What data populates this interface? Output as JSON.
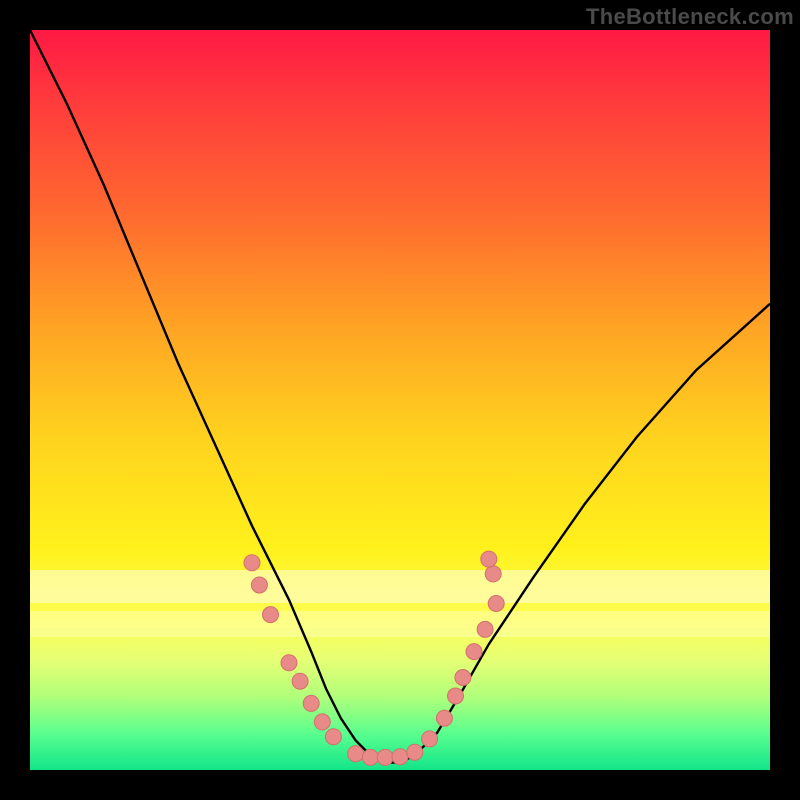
{
  "source_label": "TheBottleneck.com",
  "colors": {
    "curve": "#000000",
    "marker_fill": "#e88a87",
    "marker_stroke": "#d46f6c"
  },
  "chart_data": {
    "type": "line",
    "title": "",
    "xlabel": "",
    "ylabel": "",
    "xlim": [
      0,
      100
    ],
    "ylim": [
      0,
      100
    ],
    "series": [
      {
        "name": "bottleneck-curve",
        "x": [
          0,
          5,
          10,
          15,
          20,
          25,
          30,
          35,
          38,
          40,
          42,
          44,
          46,
          48,
          50,
          52,
          55,
          58,
          62,
          68,
          75,
          82,
          90,
          100
        ],
        "y": [
          100,
          90,
          79,
          67,
          55,
          44,
          33,
          23,
          16,
          11,
          7,
          4,
          2,
          1,
          1,
          2,
          5,
          10,
          17,
          26,
          36,
          45,
          54,
          63
        ]
      }
    ],
    "markers": {
      "name": "highlighted-points",
      "points": [
        {
          "x": 30.0,
          "y": 28.0
        },
        {
          "x": 31.0,
          "y": 25.0
        },
        {
          "x": 32.5,
          "y": 21.0
        },
        {
          "x": 35.0,
          "y": 14.5
        },
        {
          "x": 36.5,
          "y": 12.0
        },
        {
          "x": 38.0,
          "y": 9.0
        },
        {
          "x": 39.5,
          "y": 6.5
        },
        {
          "x": 41.0,
          "y": 4.5
        },
        {
          "x": 44.0,
          "y": 2.2
        },
        {
          "x": 46.0,
          "y": 1.7
        },
        {
          "x": 48.0,
          "y": 1.7
        },
        {
          "x": 50.0,
          "y": 1.8
        },
        {
          "x": 52.0,
          "y": 2.4
        },
        {
          "x": 54.0,
          "y": 4.2
        },
        {
          "x": 56.0,
          "y": 7.0
        },
        {
          "x": 57.5,
          "y": 10.0
        },
        {
          "x": 58.5,
          "y": 12.5
        },
        {
          "x": 60.0,
          "y": 16.0
        },
        {
          "x": 61.5,
          "y": 19.0
        },
        {
          "x": 63.0,
          "y": 22.5
        },
        {
          "x": 62.6,
          "y": 26.5
        },
        {
          "x": 62.0,
          "y": 28.5
        }
      ]
    }
  }
}
